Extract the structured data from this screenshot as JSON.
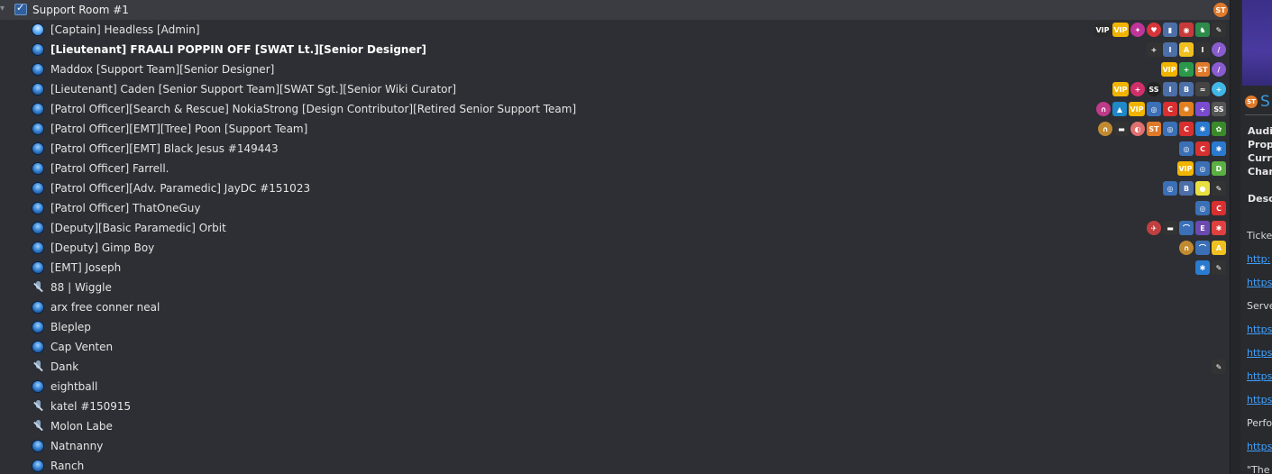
{
  "channel": {
    "name": "Support Room #1",
    "badge": "ST"
  },
  "users": [
    {
      "name": "[Captain] Headless [Admin]",
      "status": "talking",
      "bold": false,
      "badges": [
        {
          "t": "VIP",
          "c": "#2c2c2c",
          "w": 1
        },
        {
          "t": "VIP",
          "c": "#f0b400",
          "w": 1
        },
        {
          "t": "✦",
          "c": "#c0359a",
          "r": 1
        },
        {
          "t": "♥",
          "c": "#d8343c",
          "r": 1
        },
        {
          "t": "▮",
          "c": "#4c6fa8"
        },
        {
          "t": "◉",
          "c": "#c83a3a"
        },
        {
          "t": "♞",
          "c": "#2d8a4a"
        },
        {
          "t": "✎",
          "c": "#333"
        }
      ]
    },
    {
      "name": "[Lieutenant] FRAALI POPPIN OFF [SWAT Lt.][Senior Designer]",
      "status": "normal",
      "bold": true,
      "badges": [
        {
          "t": "+",
          "c": "#333"
        },
        {
          "t": "I",
          "c": "#4c6fa8"
        },
        {
          "t": "A",
          "c": "#f0c020"
        },
        {
          "t": "I",
          "c": "#333"
        },
        {
          "t": "/",
          "c": "#8a5cd0",
          "r": 1
        }
      ]
    },
    {
      "name": "Maddox [Support Team][Senior Designer]",
      "status": "normal",
      "bold": false,
      "badges": [
        {
          "t": "VIP",
          "c": "#f0b400",
          "w": 1
        },
        {
          "t": "+",
          "c": "#2a9a4a"
        },
        {
          "t": "ST",
          "c": "#e07a2a"
        },
        {
          "t": "/",
          "c": "#8a5cd0",
          "r": 1
        }
      ]
    },
    {
      "name": "[Lieutenant] Caden [Senior Support Team][SWAT Sgt.][Senior Wiki Curator]",
      "status": "normal",
      "bold": false,
      "badges": [
        {
          "t": "VIP",
          "c": "#f0b400",
          "w": 1
        },
        {
          "t": "+",
          "c": "#d0306a",
          "r": 1
        },
        {
          "t": "SS",
          "c": "#222",
          "r": 1
        },
        {
          "t": "I",
          "c": "#4c6fa8"
        },
        {
          "t": "B",
          "c": "#4c6fa8"
        },
        {
          "t": "≈",
          "c": "#444"
        },
        {
          "t": "+",
          "c": "#40b8e8",
          "r": 1
        }
      ]
    },
    {
      "name": "[Patrol Officer][Search & Rescue] NokiaStrong [Design Contributor][Retired Senior Support Team]",
      "status": "normal",
      "bold": false,
      "badges": [
        {
          "t": "∩",
          "c": "#c03a8a",
          "r": 1
        },
        {
          "t": "▲",
          "c": "#1e88c8"
        },
        {
          "t": "VIP",
          "c": "#f0b400",
          "w": 1
        },
        {
          "t": "◎",
          "c": "#3b6fb6"
        },
        {
          "t": "C",
          "c": "#d83030"
        },
        {
          "t": "✺",
          "c": "#e08020"
        },
        {
          "t": "+",
          "c": "#7a4ad0"
        },
        {
          "t": "SS",
          "c": "#555"
        }
      ]
    },
    {
      "name": "[Patrol Officer][EMT][Tree] Poon [Support Team]",
      "status": "normal",
      "bold": false,
      "badges": [
        {
          "t": "∩",
          "c": "#c08a30",
          "r": 1
        },
        {
          "t": "▬",
          "c": "#333"
        },
        {
          "t": "◐",
          "c": "#e07070",
          "r": 1
        },
        {
          "t": "ST",
          "c": "#e07a2a"
        },
        {
          "t": "◎",
          "c": "#3b6fb6"
        },
        {
          "t": "C",
          "c": "#d83030"
        },
        {
          "t": "✱",
          "c": "#2a7ad0"
        },
        {
          "t": "✿",
          "c": "#3a8a2a"
        }
      ]
    },
    {
      "name": "[Patrol Officer][EMT] Black Jesus #149443",
      "status": "normal",
      "bold": false,
      "badges": [
        {
          "t": "◎",
          "c": "#3b6fb6"
        },
        {
          "t": "C",
          "c": "#d83030"
        },
        {
          "t": "✱",
          "c": "#2a7ad0"
        }
      ]
    },
    {
      "name": "[Patrol Officer] Farrell.",
      "status": "normal",
      "bold": false,
      "badges": [
        {
          "t": "VIP",
          "c": "#f0b400",
          "w": 1
        },
        {
          "t": "◎",
          "c": "#3b6fb6"
        },
        {
          "t": "D",
          "c": "#5ab040"
        }
      ]
    },
    {
      "name": "[Patrol Officer][Adv. Paramedic] JayDC #151023",
      "status": "normal",
      "bold": false,
      "badges": [
        {
          "t": "◎",
          "c": "#3b6fb6"
        },
        {
          "t": "B",
          "c": "#4c6fa8"
        },
        {
          "t": "●",
          "c": "#e8e040"
        },
        {
          "t": "✎",
          "c": "#333"
        }
      ]
    },
    {
      "name": "[Patrol Officer] ThatOneGuy",
      "status": "normal",
      "bold": false,
      "badges": [
        {
          "t": "◎",
          "c": "#3b6fb6"
        },
        {
          "t": "C",
          "c": "#d83030"
        }
      ]
    },
    {
      "name": "[Deputy][Basic Paramedic] Orbit",
      "status": "normal",
      "bold": false,
      "badges": [
        {
          "t": "✈",
          "c": "#c04040",
          "r": 1
        },
        {
          "t": "▬",
          "c": "#333"
        },
        {
          "t": "⌒",
          "c": "#3b6fb6"
        },
        {
          "t": "E",
          "c": "#6a4ab0"
        },
        {
          "t": "✱",
          "c": "#e04040"
        }
      ]
    },
    {
      "name": "[Deputy] Gimp Boy",
      "status": "normal",
      "bold": false,
      "badges": [
        {
          "t": "∩",
          "c": "#c08a30",
          "r": 1
        },
        {
          "t": "⌒",
          "c": "#3b6fb6"
        },
        {
          "t": "A",
          "c": "#f0c020"
        }
      ]
    },
    {
      "name": "[EMT] Joseph",
      "status": "normal",
      "bold": false,
      "badges": [
        {
          "t": "✱",
          "c": "#2a7ad0"
        },
        {
          "t": "✎",
          "c": "#333"
        }
      ]
    },
    {
      "name": "88 | Wiggle",
      "status": "muted",
      "bold": false,
      "badges": []
    },
    {
      "name": "arx free conner neal",
      "status": "normal",
      "bold": false,
      "badges": []
    },
    {
      "name": "Bleplep",
      "status": "normal",
      "bold": false,
      "badges": []
    },
    {
      "name": "Cap Venten",
      "status": "normal",
      "bold": false,
      "badges": []
    },
    {
      "name": "Dank",
      "status": "muted",
      "bold": false,
      "badges": [
        {
          "t": "✎",
          "c": "#333"
        }
      ]
    },
    {
      "name": "eightball",
      "status": "normal",
      "bold": false,
      "badges": []
    },
    {
      "name": "katel #150915",
      "status": "muted",
      "bold": false,
      "badges": []
    },
    {
      "name": "Molon Labe",
      "status": "muted",
      "bold": false,
      "badges": []
    },
    {
      "name": "Natnanny",
      "status": "normal",
      "bold": false,
      "badges": []
    },
    {
      "name": "Ranch",
      "status": "normal",
      "bold": false,
      "badges": []
    }
  ],
  "info_panel": {
    "server_badge": "ST",
    "server_name": "S",
    "labels": [
      "Audio",
      "Prop",
      "Curre",
      "Chan"
    ],
    "desc_label": "Desc",
    "ticket_text": "Ticket",
    "links_a": [
      "http:",
      "https:"
    ],
    "server_text": "Serve",
    "links_b": [
      "https:",
      "https:",
      "https:",
      "https:"
    ],
    "perf_text": "Perfor",
    "link_c": "https:",
    "quote": "\"The c"
  }
}
